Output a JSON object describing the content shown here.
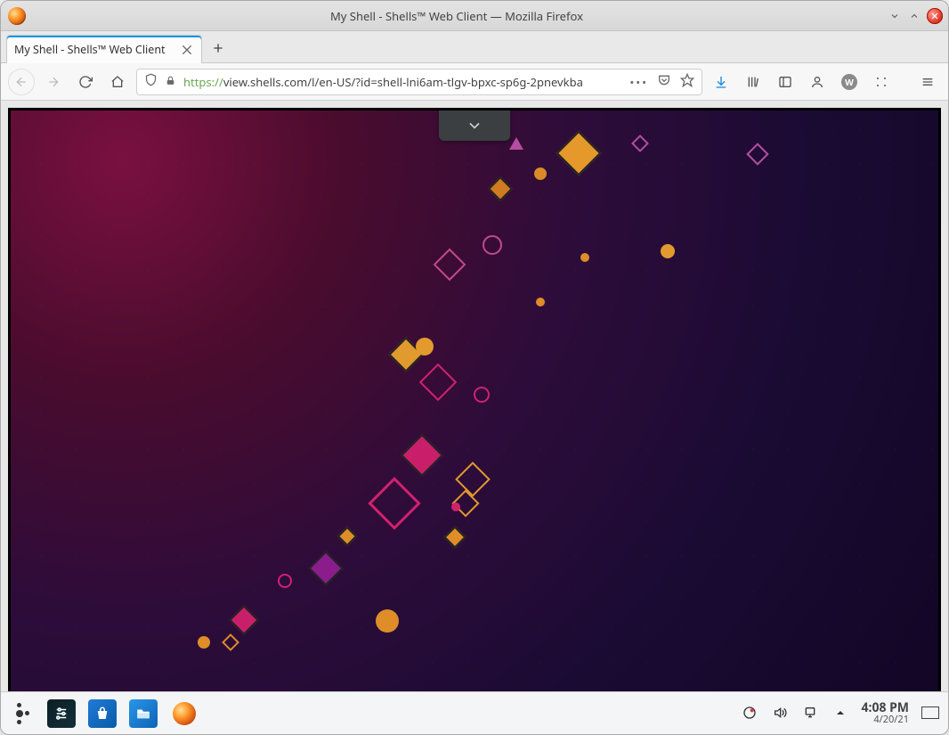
{
  "window": {
    "title": "My Shell - Shells™ Web Client — Mozilla Firefox"
  },
  "browser": {
    "tab_title": "My Shell - Shells™ Web Client",
    "url_scheme": "https://",
    "url_host_path": "view.shells.com/l/en-US/?id=shell-lni6am-tlgv-bpxc-sp6g-2pnevkba",
    "page_actions_dots": "•••",
    "account_letter": "W"
  },
  "panel": {
    "time": "4:08 PM",
    "date": "4/20/21"
  },
  "icons": {
    "down_chevron": "chevron-down",
    "up_chevron": "chevron-up",
    "close": "close"
  }
}
